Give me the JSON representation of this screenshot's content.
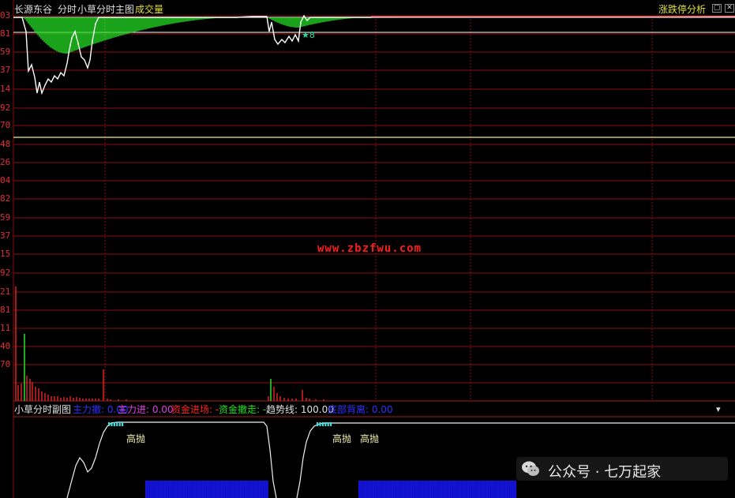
{
  "header": {
    "stock_name": "长源东谷",
    "mode": "分时",
    "indicator_name": "小草分时主图",
    "volume_label": "成交量",
    "analysis_button": "涨跌停分析",
    "btn_restore": "▢",
    "btn_close": "✕"
  },
  "watermark": "www.zbzfwu.com",
  "y_axis_labels": [
    "03",
    "81",
    "59",
    "37",
    "14",
    "92",
    "70",
    "48",
    "26",
    "04",
    "82",
    "59",
    "37",
    "15",
    "92",
    "21",
    "81",
    "11",
    "40",
    "70"
  ],
  "main_chart": {
    "star_label": "★8"
  },
  "sub_panel": {
    "title": "小草分时副图",
    "items": [
      {
        "label": "主力撤:",
        "value": "0.00",
        "color": "#3030ff"
      },
      {
        "label": "主力进:",
        "value": "0.00",
        "color": "#e040e0"
      },
      {
        "label": "资金进场:",
        "value": "-",
        "color": "#ff2020"
      },
      {
        "label": "资金撤走:",
        "value": "-",
        "color": "#20e020"
      },
      {
        "label": "趋势线:",
        "value": "100.00",
        "color": "#e0e0e0"
      },
      {
        "label": "底部背离:",
        "value": "0.00",
        "color": "#3030ff"
      }
    ],
    "collapse_icon": "▾",
    "annotations": [
      "高抛",
      "高抛",
      "高抛"
    ]
  },
  "wechat": {
    "text": "公众号 · 七万起家"
  },
  "colors": {
    "grid": "#8a0e0e",
    "price_line": "#ffffff",
    "area_fill": "#22d822",
    "yellow_line": "#f0f080",
    "volume_bar": "#cc2020",
    "volume_bar_up": "#22d822",
    "blue_band": "#1414dd",
    "cyan_marker": "#40e0e0"
  }
}
